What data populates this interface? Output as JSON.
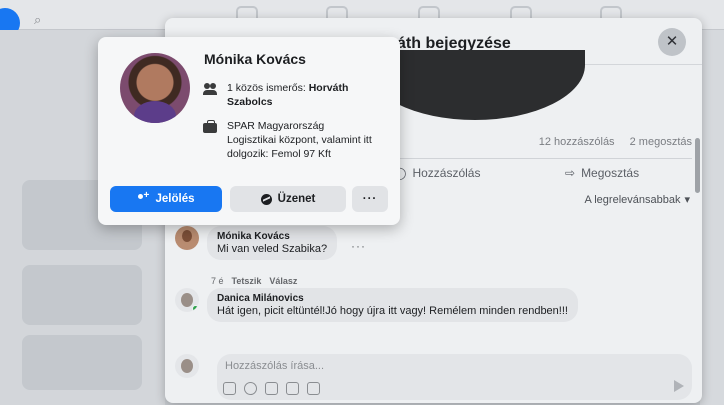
{
  "hover_card": {
    "name": "Mónika Kovács",
    "mutual_prefix": "1 közös ismerős: ",
    "mutual_name": "Horváth Szabolcs",
    "work": "SPAR Magyarország Logisztikai központ, valamint itt dolgozik: Femol 97 Kft",
    "buttons": {
      "add_friend": "Jelölés",
      "message": "Üzenet",
      "more": "···"
    }
  },
  "post": {
    "title_fragment": "áth bejegyzése",
    "close_label": "✕",
    "stats": {
      "comments": "12 hozzászólás",
      "shares": "2 megosztás"
    },
    "actions": {
      "comment": "Hozzászólás",
      "share": "Megosztás"
    },
    "sort_label": "A legrelevánsabbak",
    "sort_icon": "caret-down-icon"
  },
  "comments": [
    {
      "author": "Mónika Kovács",
      "text": "Mi van veled Szabika?",
      "meta": {
        "time": "7 é",
        "like": "Tetszik",
        "reply": "Válasz"
      },
      "more": "···"
    },
    {
      "author": "Danica Milánovics",
      "text": "Hát igen, picit eltüntél!Jó hogy újra itt vagy! Remélem minden rendben!!!"
    }
  ],
  "composer": {
    "placeholder": "Hozzászólás írása..."
  },
  "colors": {
    "primary": "#1877f2",
    "online": "#31a24c",
    "modal_bg": "#eef0f2",
    "card_bg": "#f6f7f8"
  }
}
